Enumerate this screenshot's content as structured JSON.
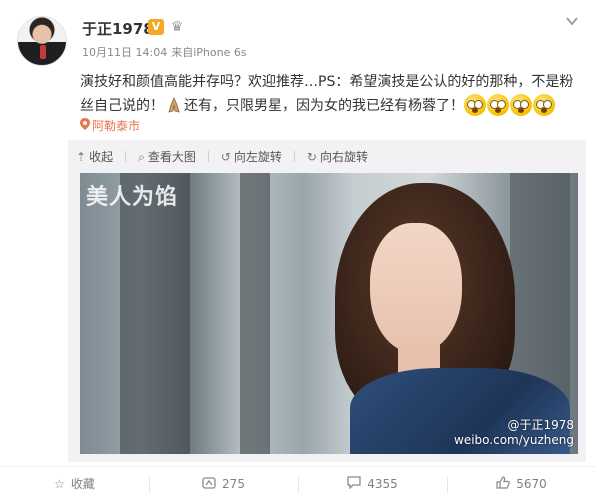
{
  "header": {
    "username": "于正1978",
    "verified_badge": "V",
    "member_icon": "crown-icon",
    "time": "10月11日 14:04",
    "source_prefix": "来自",
    "source": "iPhone 6s",
    "menu_icon": "chevron-down-icon"
  },
  "post": {
    "text_part1": "演技好和颜值高能并存吗？欢迎推荐…PS：希望演技是公认的好的那种，不是粉丝自己说的！",
    "text_part2": "还有，只限男星，因为女的我已经有杨蓉了！",
    "emoji_count": 4,
    "location": "阿勒泰市"
  },
  "media_toolbar": {
    "collapse": "收起",
    "view_large": "查看大图",
    "rotate_left": "向左旋转",
    "rotate_right": "向右旋转"
  },
  "photo": {
    "show_title": "美人为馅",
    "watermark_handle": "@于正1978",
    "watermark_url": "weibo.com/yuzheng"
  },
  "actions": {
    "favorite": "收藏",
    "repost_count": "275",
    "comment_count": "4355",
    "like_count": "5670"
  },
  "colors": {
    "location": "#eb7350",
    "badge": "#f5a623",
    "toolbar_bg": "#f2f2f5"
  }
}
